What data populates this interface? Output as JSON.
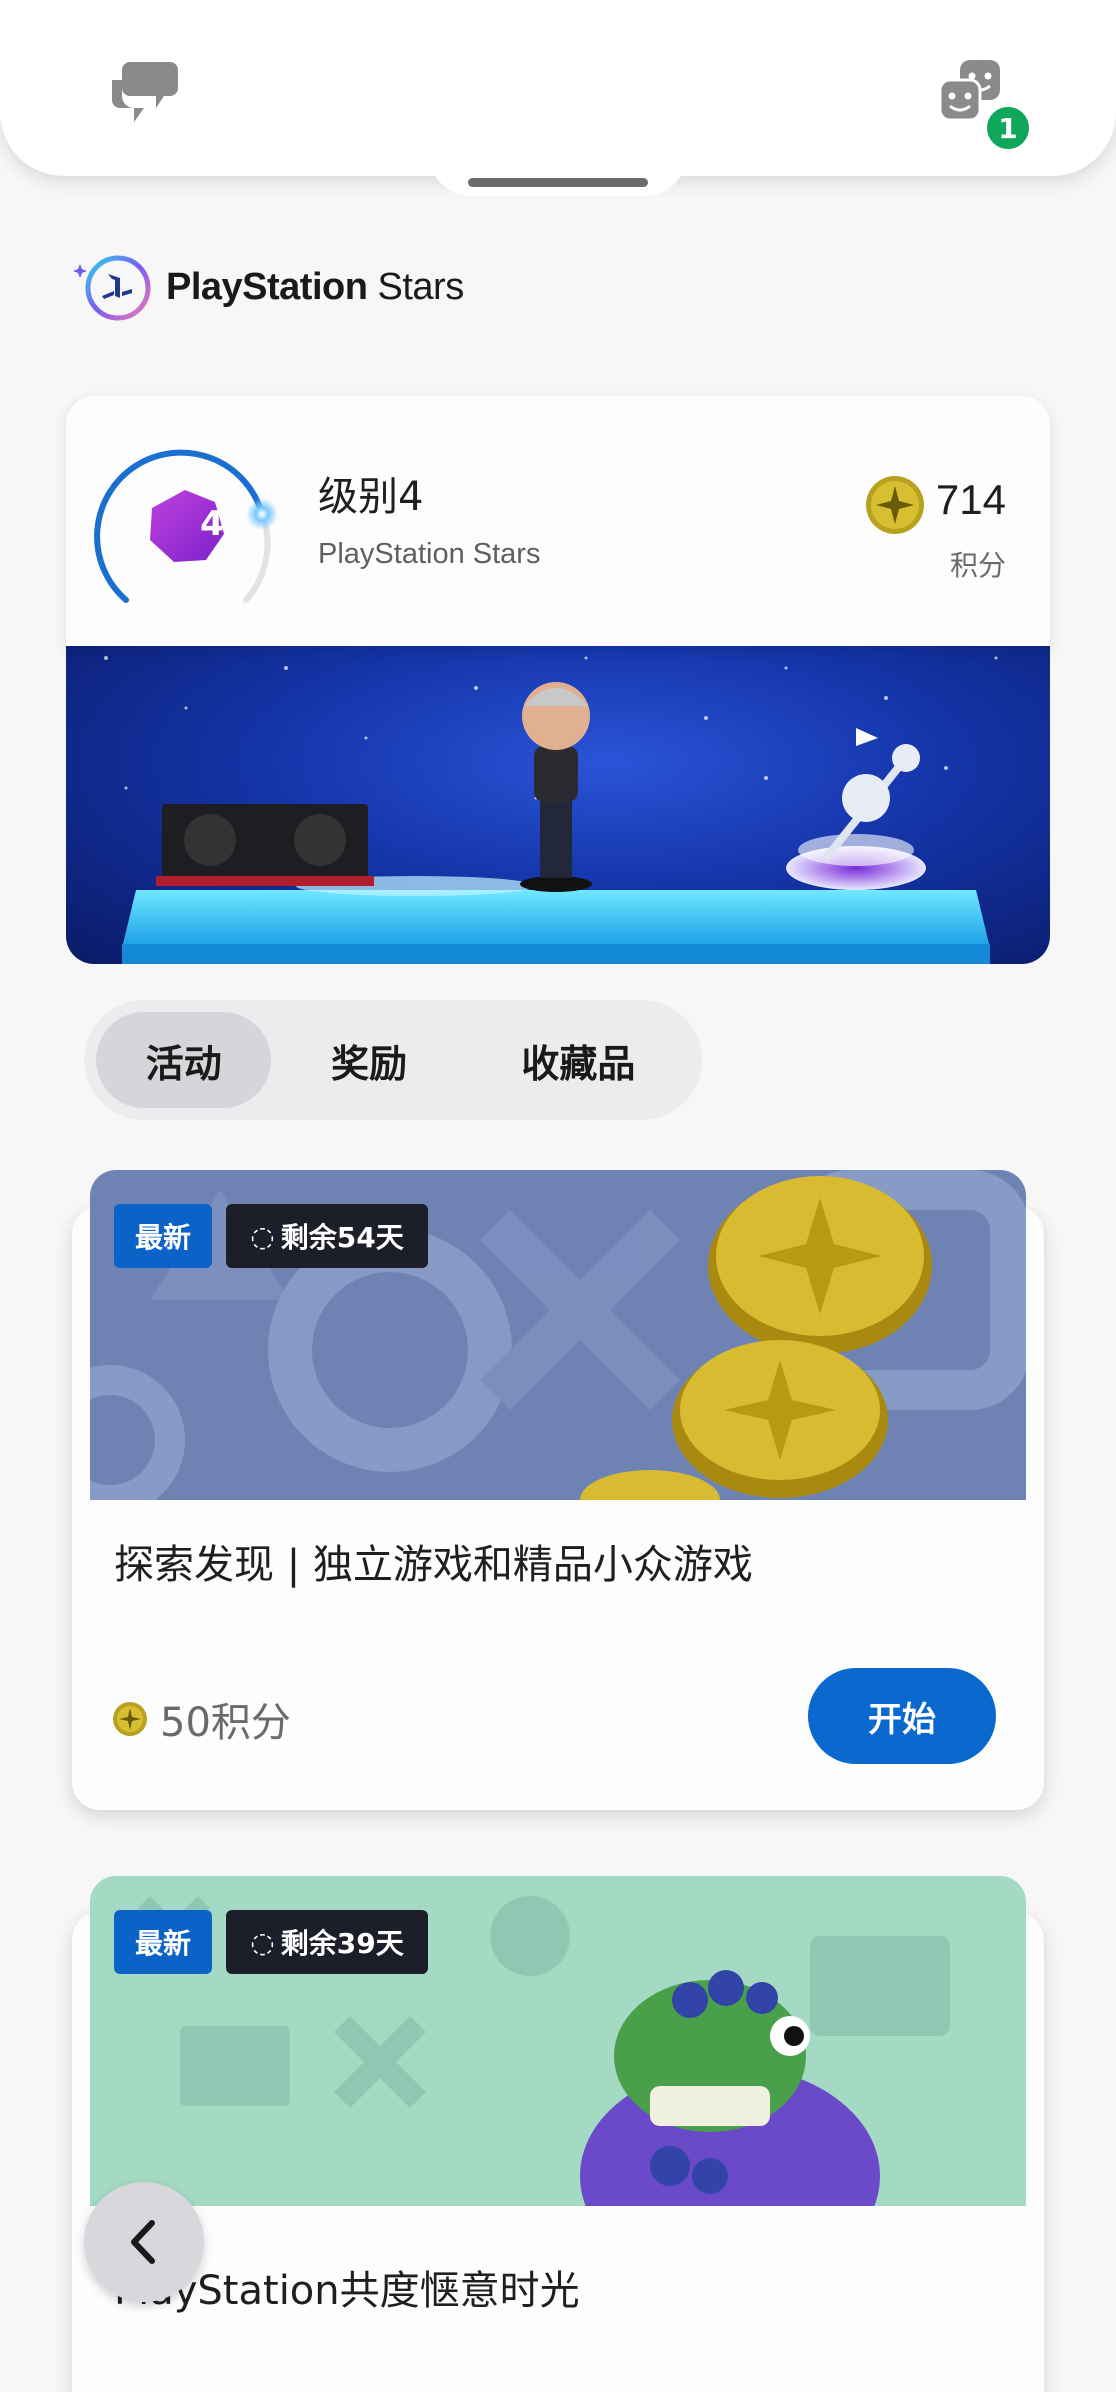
{
  "top_bar": {
    "chat_icon": "chat-bubbles-icon",
    "friends_icon": "game-friends-icon",
    "notification_count": "1"
  },
  "brand": {
    "logo": "playstation-stars-logo",
    "name_bold": "PlayStation",
    "name_light": "Stars"
  },
  "level": {
    "badge_number": "4",
    "title": "级别4",
    "subtitle": "PlayStation Stars",
    "points_value": "714",
    "points_label": "积分"
  },
  "tabs": [
    {
      "label": "活动",
      "selected": true
    },
    {
      "label": "奖励",
      "selected": false
    },
    {
      "label": "收藏品",
      "selected": false
    }
  ],
  "activities": [
    {
      "badge_new": "最新",
      "time_left": "剩余54天",
      "title": "探索发现 | 独立游戏和精品小众游戏",
      "reward": "50积分",
      "button_label": "开始"
    },
    {
      "badge_new": "最新",
      "time_left": "剩余39天",
      "title": "PlayStation共度惬意时光"
    }
  ],
  "colors": {
    "accent_blue": "#0b68cf",
    "badge_green": "#0fa85a",
    "level_purple": "#9b2fd6"
  }
}
